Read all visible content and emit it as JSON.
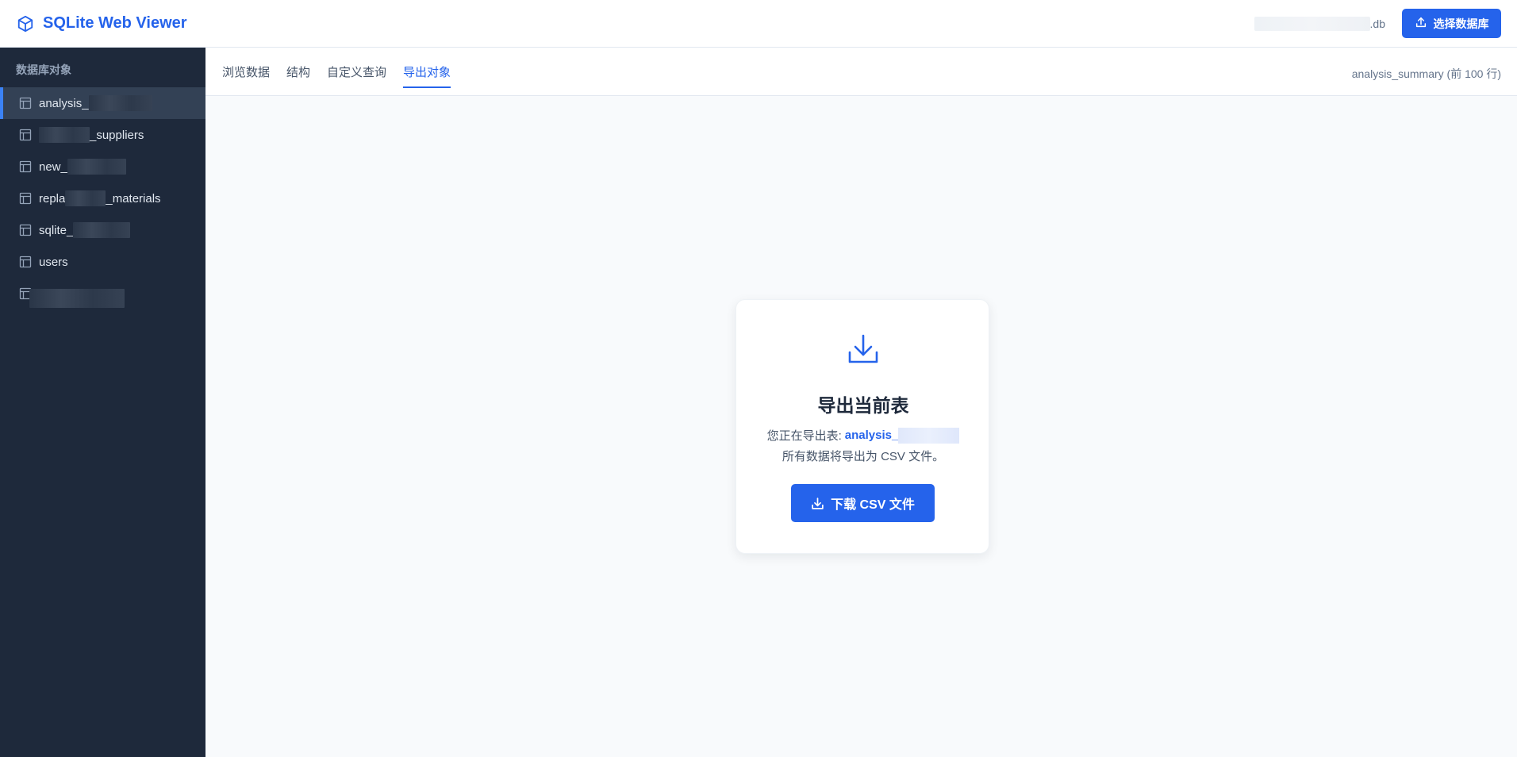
{
  "app": {
    "title": "SQLite Web Viewer",
    "db_file_suffix": ".db",
    "select_db_label": "选择数据库"
  },
  "sidebar": {
    "heading": "数据库对象",
    "items": [
      {
        "prefix": "analysis_",
        "suffix": "",
        "active": true
      },
      {
        "prefix": "",
        "suffix": "_suppliers",
        "active": false
      },
      {
        "prefix": "new_",
        "suffix": "",
        "active": false
      },
      {
        "prefix": "repla",
        "suffix": "_materials",
        "active": false
      },
      {
        "prefix": "sqlite_",
        "suffix": "",
        "active": false
      },
      {
        "prefix": "users",
        "suffix": "",
        "active": false
      },
      {
        "prefix": "",
        "suffix": "",
        "active": false
      }
    ]
  },
  "tabs": {
    "items": [
      {
        "label": "浏览数据"
      },
      {
        "label": "结构"
      },
      {
        "label": "自定义查询"
      },
      {
        "label": "导出对象"
      }
    ],
    "active_index": 3,
    "info": "analysis_summary (前 100 行)"
  },
  "export": {
    "title": "导出当前表",
    "exporting_label": "您正在导出表:",
    "table_prefix": "analysis_",
    "description": "所有数据将导出为 CSV 文件。",
    "download_label": "下载 CSV 文件"
  },
  "colors": {
    "accent": "#2563eb",
    "sidebar_bg": "#1e293b",
    "sidebar_active": "#334155"
  },
  "icons": {
    "brand": "cube-icon",
    "select_db": "upload-icon",
    "table": "table-icon",
    "export": "download-icon"
  }
}
